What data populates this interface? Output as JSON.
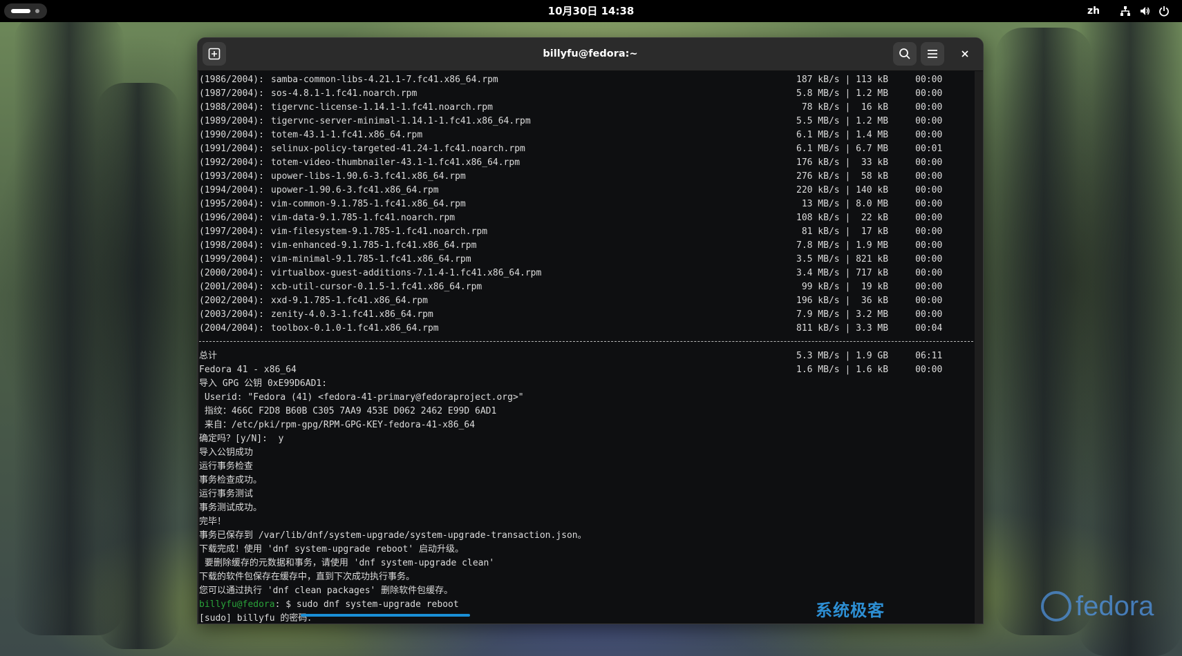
{
  "topbar": {
    "datetime": "10月30日 14:38",
    "input_method": "zh"
  },
  "window": {
    "title": "billyfu@fedora:~"
  },
  "terminal": {
    "downloads": [
      {
        "num": "(1986/2004):",
        "name": "samba-common-libs-4.21.1-7.fc41.x86_64.rpm",
        "stat": "187 kB/s | 113 kB     00:00"
      },
      {
        "num": "(1987/2004):",
        "name": "sos-4.8.1-1.fc41.noarch.rpm",
        "stat": "5.8 MB/s | 1.2 MB     00:00"
      },
      {
        "num": "(1988/2004):",
        "name": "tigervnc-license-1.14.1-1.fc41.noarch.rpm",
        "stat": " 78 kB/s |  16 kB     00:00"
      },
      {
        "num": "(1989/2004):",
        "name": "tigervnc-server-minimal-1.14.1-1.fc41.x86_64.rpm",
        "stat": "5.5 MB/s | 1.2 MB     00:00"
      },
      {
        "num": "(1990/2004):",
        "name": "totem-43.1-1.fc41.x86_64.rpm",
        "stat": "6.1 MB/s | 1.4 MB     00:00"
      },
      {
        "num": "(1991/2004):",
        "name": "selinux-policy-targeted-41.24-1.fc41.noarch.rpm",
        "stat": "6.1 MB/s | 6.7 MB     00:01"
      },
      {
        "num": "(1992/2004):",
        "name": "totem-video-thumbnailer-43.1-1.fc41.x86_64.rpm",
        "stat": "176 kB/s |  33 kB     00:00"
      },
      {
        "num": "(1993/2004):",
        "name": "upower-libs-1.90.6-3.fc41.x86_64.rpm",
        "stat": "276 kB/s |  58 kB     00:00"
      },
      {
        "num": "(1994/2004):",
        "name": "upower-1.90.6-3.fc41.x86_64.rpm",
        "stat": "220 kB/s | 140 kB     00:00"
      },
      {
        "num": "(1995/2004):",
        "name": "vim-common-9.1.785-1.fc41.x86_64.rpm",
        "stat": " 13 MB/s | 8.0 MB     00:00"
      },
      {
        "num": "(1996/2004):",
        "name": "vim-data-9.1.785-1.fc41.noarch.rpm",
        "stat": "108 kB/s |  22 kB     00:00"
      },
      {
        "num": "(1997/2004):",
        "name": "vim-filesystem-9.1.785-1.fc41.noarch.rpm",
        "stat": " 81 kB/s |  17 kB     00:00"
      },
      {
        "num": "(1998/2004):",
        "name": "vim-enhanced-9.1.785-1.fc41.x86_64.rpm",
        "stat": "7.8 MB/s | 1.9 MB     00:00"
      },
      {
        "num": "(1999/2004):",
        "name": "vim-minimal-9.1.785-1.fc41.x86_64.rpm",
        "stat": "3.5 MB/s | 821 kB     00:00"
      },
      {
        "num": "(2000/2004):",
        "name": "virtualbox-guest-additions-7.1.4-1.fc41.x86_64.rpm",
        "stat": "3.4 MB/s | 717 kB     00:00"
      },
      {
        "num": "(2001/2004):",
        "name": "xcb-util-cursor-0.1.5-1.fc41.x86_64.rpm",
        "stat": " 99 kB/s |  19 kB     00:00"
      },
      {
        "num": "(2002/2004):",
        "name": "xxd-9.1.785-1.fc41.x86_64.rpm",
        "stat": "196 kB/s |  36 kB     00:00"
      },
      {
        "num": "(2003/2004):",
        "name": "zenity-4.0.3-1.fc41.x86_64.rpm",
        "stat": "7.9 MB/s | 3.2 MB     00:00"
      },
      {
        "num": "(2004/2004):",
        "name": "toolbox-0.1.0-1.fc41.x86_64.rpm",
        "stat": "811 kB/s | 3.3 MB     00:04"
      }
    ],
    "total": {
      "label": "总计",
      "stat": "5.3 MB/s | 1.9 GB     06:11"
    },
    "repo": {
      "label": "Fedora 41 - x86_64",
      "stat": "1.6 MB/s | 1.6 kB     00:00"
    },
    "messages": [
      "导入 GPG 公钥 0xE99D6AD1:",
      " Userid: \"Fedora (41) <fedora-41-primary@fedoraproject.org>\"",
      " 指纹：466C F2D8 B60B C305 7AA9 453E D062 2462 E99D 6AD1",
      " 来自：/etc/pki/rpm-gpg/RPM-GPG-KEY-fedora-41-x86_64",
      "确定吗？[y/N]:  y",
      "导入公钥成功",
      "运行事务检查",
      "事务检查成功。",
      "运行事务测试",
      "事务测试成功。",
      "完毕！",
      "事务已保存到 /var/lib/dnf/system-upgrade/system-upgrade-transaction.json。",
      "下载完成！使用 'dnf system-upgrade reboot' 启动升级。",
      " 要删除缓存的元数据和事务，请使用 'dnf system-upgrade clean'",
      "下载的软件包保存在缓存中，直到下次成功执行事务。",
      "您可以通过执行 'dnf clean packages' 删除软件包缓存。"
    ],
    "prompt_user": "billyfu@fedora",
    "prompt_rest": ": $ sudo dnf system-upgrade reboot",
    "sudo_prompt": "[sudo] billyfu 的密码："
  },
  "watermark": {
    "site": "系统极客",
    "distro": "fedora"
  },
  "colors": {
    "prompt_green": "#2aa33a",
    "highlight_blue": "#1a8fd6"
  }
}
